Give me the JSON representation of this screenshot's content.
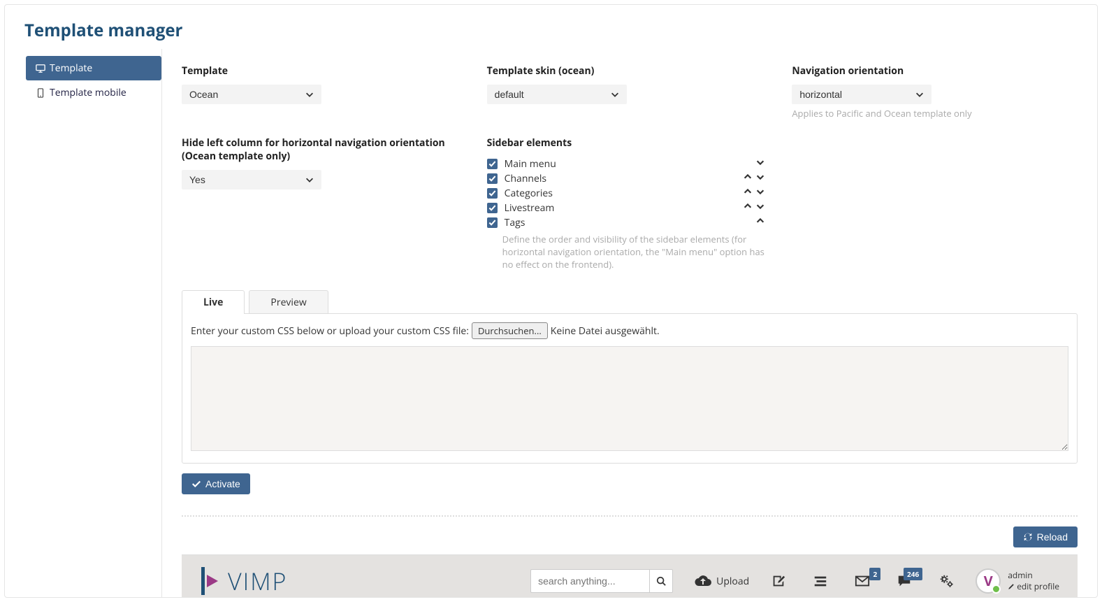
{
  "page": {
    "title": "Template manager"
  },
  "sidebar": {
    "items": [
      {
        "label": "Template",
        "active": true
      },
      {
        "label": "Template mobile",
        "active": false
      }
    ]
  },
  "form": {
    "template": {
      "label": "Template",
      "value": "Ocean"
    },
    "skin": {
      "label": "Template skin (ocean)",
      "value": "default"
    },
    "nav": {
      "label": "Navigation orientation",
      "value": "horizontal",
      "hint": "Applies to Pacific and Ocean template only"
    },
    "hideLeft": {
      "label": "Hide left column for horizontal navigation orientation (Ocean template only)",
      "value": "Yes"
    },
    "sidebarElements": {
      "label": "Sidebar elements",
      "hint": "Define the order and visibility of the sidebar elements (for horizontal navigation orientation, the \"Main menu\" option has no effect on the frontend).",
      "items": [
        {
          "label": "Main menu",
          "up": false,
          "down": true
        },
        {
          "label": "Channels",
          "up": true,
          "down": true
        },
        {
          "label": "Categories",
          "up": true,
          "down": true
        },
        {
          "label": "Livestream",
          "up": true,
          "down": true
        },
        {
          "label": "Tags",
          "up": true,
          "down": false
        }
      ]
    }
  },
  "tabs": {
    "live": "Live",
    "preview": "Preview",
    "active": "live"
  },
  "css": {
    "prompt": "Enter your custom CSS below or upload your custom CSS file:",
    "browse": "Durchsuchen...",
    "noFile": "Keine Datei ausgewählt."
  },
  "buttons": {
    "activate": "Activate",
    "reload": "Reload"
  },
  "footer": {
    "logo": "VIMP",
    "searchPlaceholder": "search anything...",
    "upload": "Upload",
    "badge1": "2",
    "badge2": "246",
    "user": "admin",
    "editProfile": "edit profile"
  }
}
